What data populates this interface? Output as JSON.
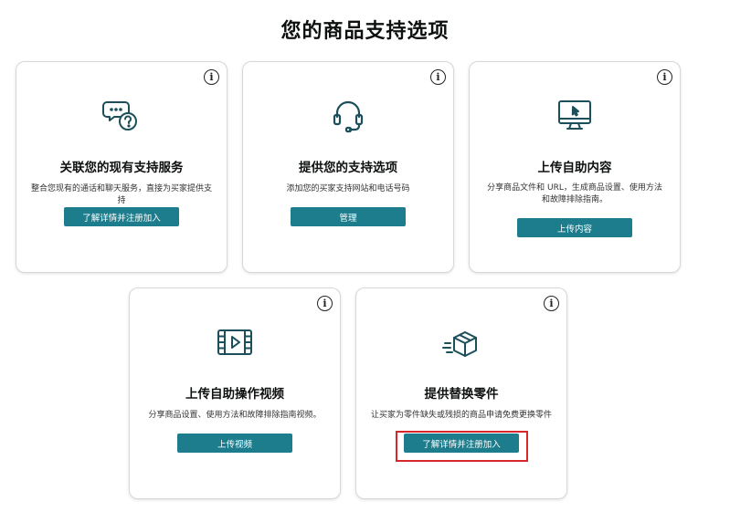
{
  "page": {
    "title": "您的商品支持选项"
  },
  "accent_color": "#1d7d8c",
  "highlight_color": "#d8272b",
  "cards": [
    {
      "icon": "chat-question-icon",
      "title": "关联您的现有支持服务",
      "description": "整合您现有的通话和聊天服务，直接为买家提供支持",
      "button": "了解详情并注册加入"
    },
    {
      "icon": "headset-icon",
      "title": "提供您的支持选项",
      "description": "添加您的买家支持网站和电话号码",
      "button": "管理"
    },
    {
      "icon": "monitor-cursor-icon",
      "title": "上传自助内容",
      "description": "分享商品文件和 URL，生成商品设置、使用方法和故障排除指南。",
      "button": "上传内容"
    },
    {
      "icon": "video-film-icon",
      "title": "上传自助操作视频",
      "description": "分享商品设置、使用方法和故障排除指南视频。",
      "button": "上传视频"
    },
    {
      "icon": "package-delivery-icon",
      "title": "提供替换零件",
      "description": "让买家为零件缺失或残损的商品申请免费更换零件",
      "button": "了解详情并注册加入",
      "highlighted": true
    }
  ]
}
